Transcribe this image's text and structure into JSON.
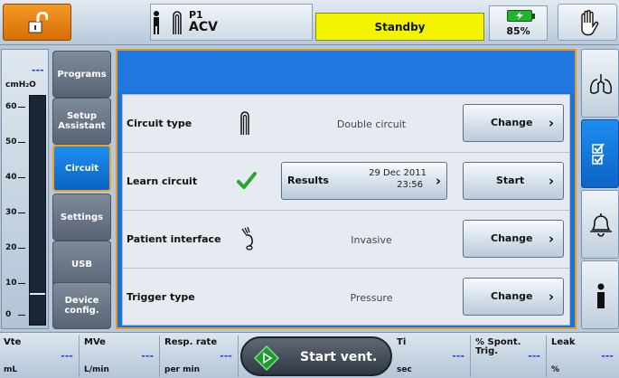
{
  "topbar": {
    "lock_icon": "unlock-icon",
    "patient_id": "P1",
    "patient_icons": [
      "adult-person-icon",
      "double-circuit-icon"
    ],
    "mode": "ACV",
    "status": "Standby",
    "battery_pct": "85%",
    "battery_level": 0.85,
    "hand_icon": "hand-stop-icon"
  },
  "pressure": {
    "value": "---",
    "unit": "cmH₂O",
    "ticks": [
      "60",
      "50",
      "40",
      "30",
      "20",
      "10",
      "0"
    ]
  },
  "nav": {
    "items": [
      "Programs",
      "Setup\nAssistant",
      "Circuit",
      "Settings",
      "USB",
      "Device\nconfig."
    ],
    "active": "Circuit"
  },
  "circuit": {
    "rows": [
      {
        "label": "Circuit type",
        "icon": "double-circuit-icon",
        "value": "Double circuit",
        "button": "Change"
      },
      {
        "label": "Learn circuit",
        "icon": "checkmark-icon",
        "result_label": "Results",
        "result_date": "29 Dec 2011",
        "result_time": "23:56",
        "button": "Start"
      },
      {
        "label": "Patient interface",
        "icon": "invasive-interface-icon",
        "value": "Invasive",
        "button": "Change"
      },
      {
        "label": "Trigger type",
        "value": "Pressure",
        "button": "Change"
      }
    ]
  },
  "right_nav": {
    "icons": [
      "lungs-icon",
      "checklist-icon",
      "alarm-bell-icon",
      "info-icon"
    ],
    "active": "checklist-icon"
  },
  "bottombar": {
    "params": [
      {
        "name": "Vte",
        "unit": "mL",
        "value": "---"
      },
      {
        "name": "MVe",
        "unit": "L/min",
        "value": "---"
      },
      {
        "name": "Resp. rate",
        "unit": "per min",
        "value": "---"
      },
      {
        "name": "Ti",
        "unit": "sec",
        "value": "---"
      },
      {
        "name": "% Spont.\nTrig.",
        "unit": "",
        "value": "---"
      },
      {
        "name": "Leak",
        "unit": "%",
        "value": "---"
      }
    ],
    "start_label": "Start vent."
  }
}
